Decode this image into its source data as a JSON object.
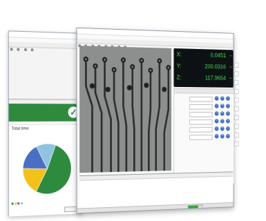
{
  "colors": {
    "accent_green": "#2e8b3e",
    "dro_green": "#3fe05a",
    "button_blue": "#3d6fc7"
  },
  "dro": {
    "rows": [
      {
        "axis": "X:",
        "value": "0.0451",
        "unit": "mm"
      },
      {
        "axis": "Y:",
        "value": "200.0316",
        "unit": "mm"
      },
      {
        "axis": "Z:",
        "value": "117.9654",
        "unit": "mm"
      }
    ]
  },
  "report": {
    "total_label": "Total time",
    "chart_data": {
      "type": "pie",
      "categories": [
        "A",
        "B",
        "C",
        "D"
      ],
      "values": [
        52,
        18,
        17,
        13
      ],
      "colors": [
        "#2e8b3e",
        "#f2c21a",
        "#4a6fc2",
        "#8fc3e0"
      ]
    }
  },
  "status": {
    "progress": 0.7
  }
}
